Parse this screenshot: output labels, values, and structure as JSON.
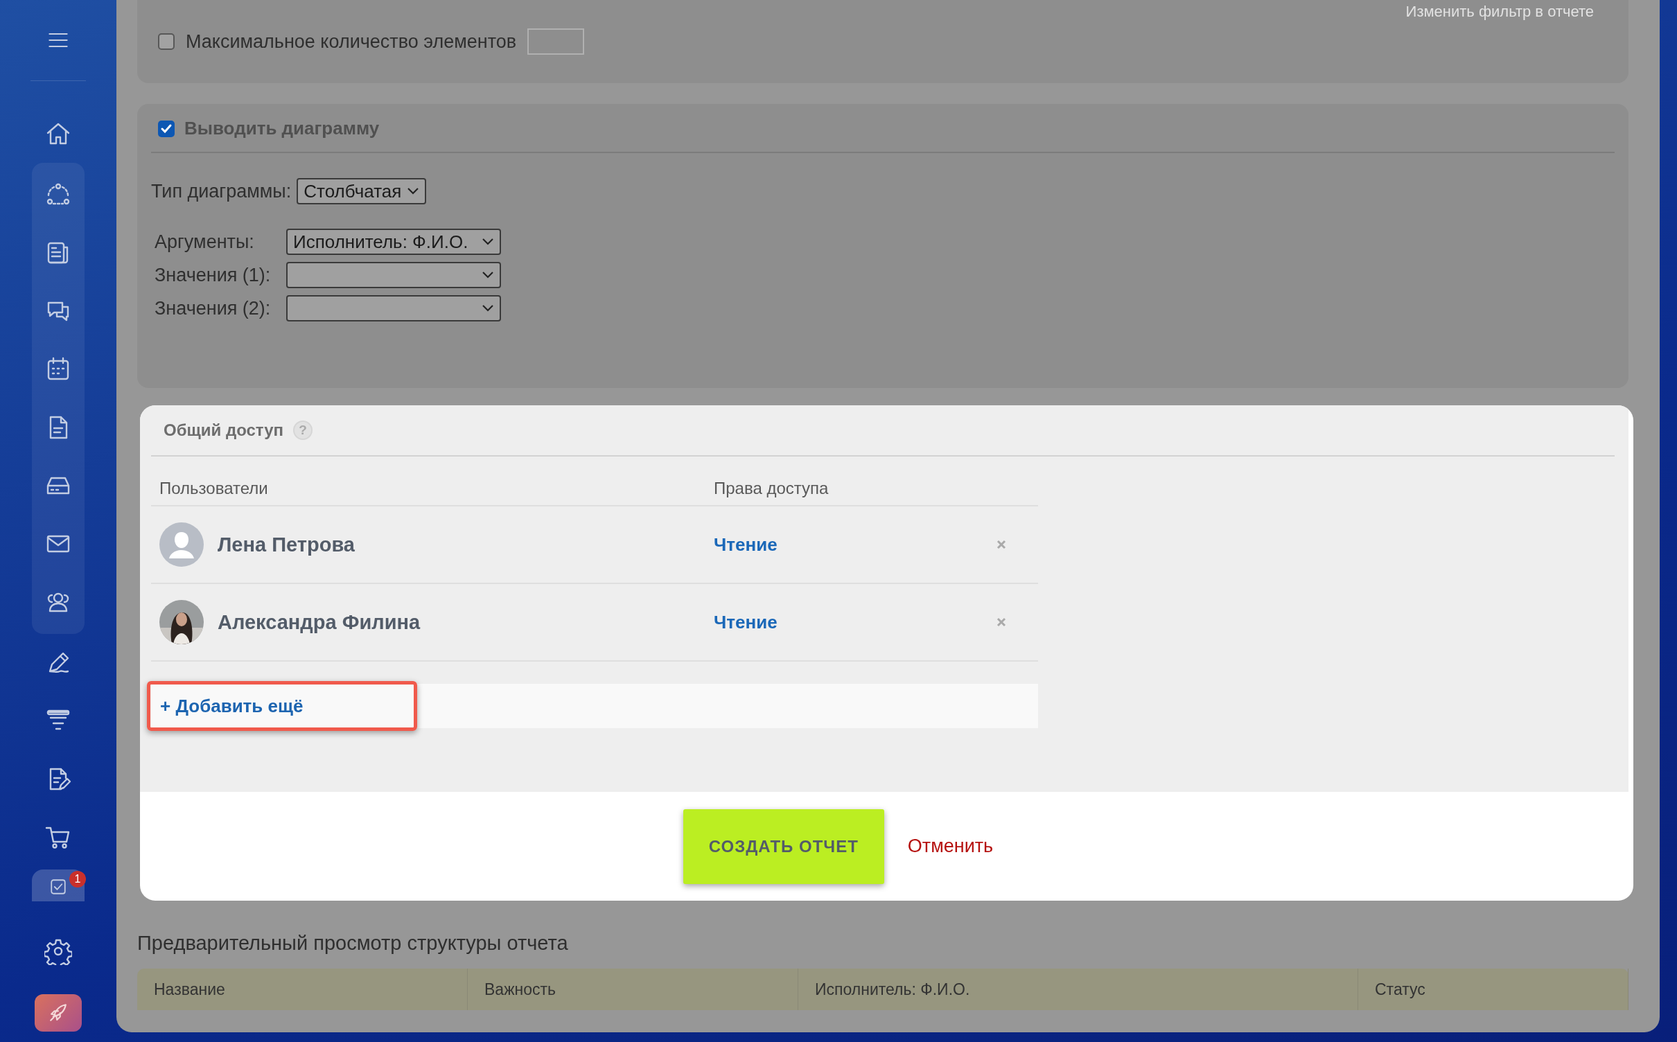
{
  "sidebar": {
    "badge": "1"
  },
  "limit_section": {
    "checkbox_label": "Максимальное количество элементов",
    "checked": false,
    "link": "Изменить фильтр в отчете"
  },
  "chart_section": {
    "checkbox_label": "Выводить диаграмму",
    "checked": true,
    "type_label": "Тип диаграммы:",
    "type_value": "Столбчатая",
    "fields": [
      {
        "label": "Аргументы:",
        "value": "Исполнитель: Ф.И.О."
      },
      {
        "label": "Значения (1):"
      },
      {
        "label": "Значения (2):"
      }
    ]
  },
  "sharing": {
    "title": "Общий доступ",
    "help": "?",
    "columns": [
      "Пользователи",
      "Права доступа"
    ],
    "users": [
      {
        "name": "Лена Петрова",
        "kind": "silhouette",
        "access": "Чтение"
      },
      {
        "name": "Александра Филина",
        "kind": "picture",
        "access": "Чтение"
      }
    ],
    "add_link": {
      "label": "+ Добавить ещё",
      "highlighted": true
    }
  },
  "actions": {
    "create": {
      "label": "СОЗДАТЬ ОТЧЕТ",
      "highlighted": true
    },
    "cancel": "Отменить"
  },
  "preview": {
    "title": "Предварительный просмотр структуры отчета",
    "columns": [
      "Название",
      "Важность",
      "Исполнитель: Ф.И.О.",
      "Статус"
    ]
  }
}
